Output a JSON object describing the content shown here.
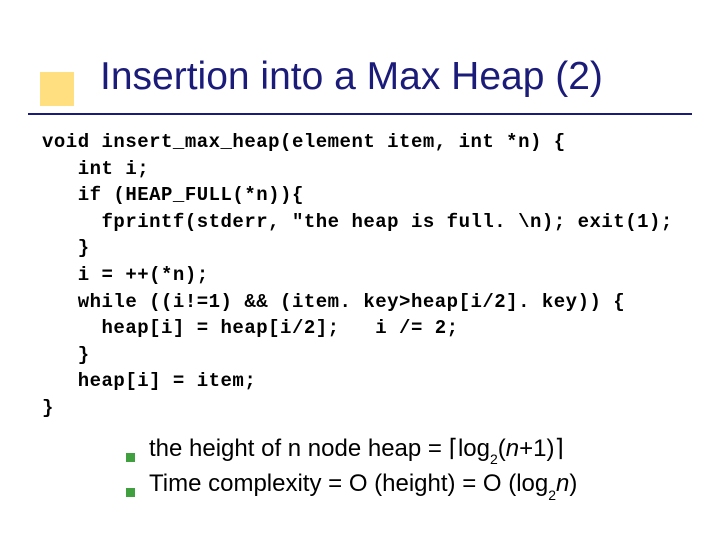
{
  "title": "Insertion into a Max Heap (2)",
  "code": "void insert_max_heap(element item, int *n) {\n   int i;\n   if (HEAP_FULL(*n)){\n     fprintf(stderr, \"the heap is full. \\n); exit(1);\n   }\n   i = ++(*n);\n   while ((i!=1) && (item. key>heap[i/2]. key)) {\n     heap[i] = heap[i/2];   i /= 2;\n   }\n   heap[i] = item;\n}",
  "bullet1": {
    "prefix": "the height of n node heap = ",
    "lceil": "⌈",
    "log": "log",
    "base": "2",
    "lparen": "(",
    "n": "n",
    "plus": "+1)",
    "rceil": "⌉"
  },
  "bullet2": {
    "text1": "Time complexity = O (height) = O (log",
    "base": "2",
    "n": "n",
    "rparen": ")"
  }
}
